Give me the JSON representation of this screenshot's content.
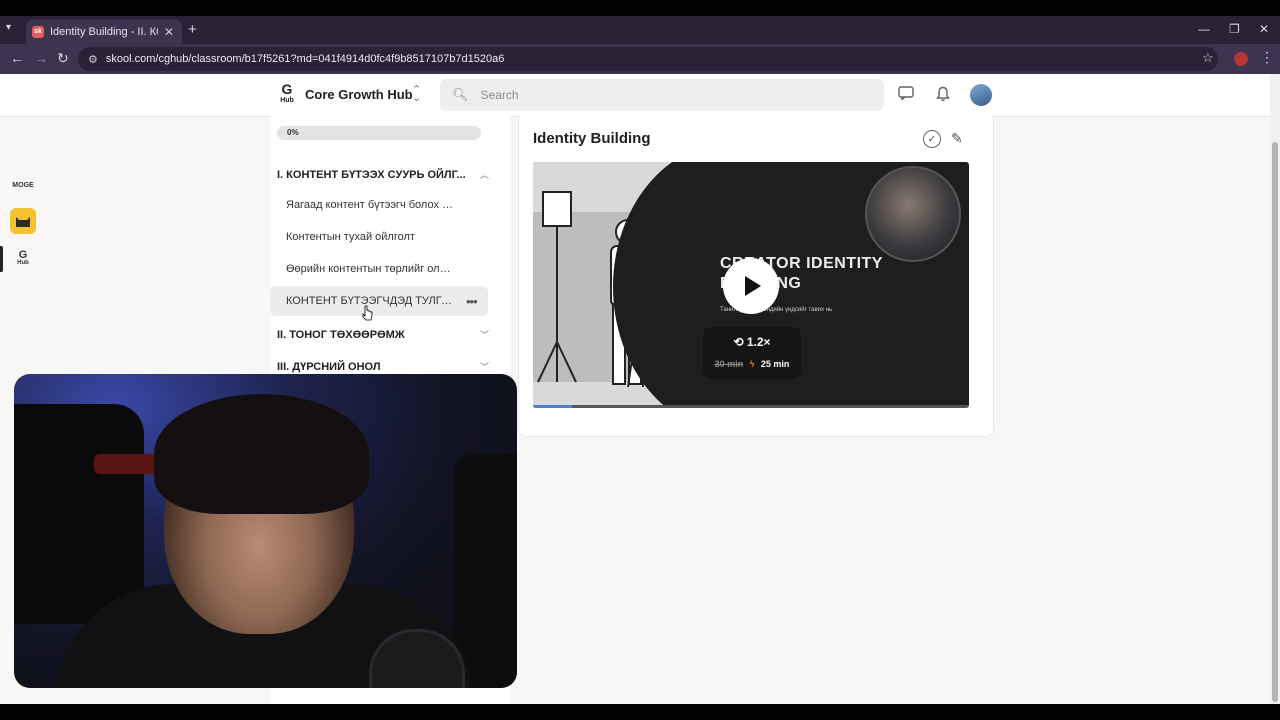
{
  "browser": {
    "tab_title": "Identity Building - II. КОНТЕНТ",
    "tab_favicon": "sk",
    "new_tab_icon": "plus-icon",
    "url": "skool.com/cghub/classroom/b17f5261?md=041f4914d0fc4f9b8517107b7d1520a6"
  },
  "header": {
    "logo_letter": "G",
    "logo_sub": "Hub",
    "group_name": "Core Growth Hub",
    "search_placeholder": "Search"
  },
  "rail": {
    "items": [
      {
        "label": "MOGE"
      },
      {
        "label": "cat-logo"
      },
      {
        "letter": "G",
        "sub": "Hub"
      }
    ]
  },
  "sidebar": {
    "progress_label": "0%",
    "progress_value": 0,
    "sections": [
      {
        "title": "I. КОНТЕНТ БҮТЭЭХ СУУРЬ ОЙЛГ...",
        "expanded": true
      },
      {
        "title": "II. ТОНОГ ТӨХӨӨРӨМЖ",
        "expanded": false
      },
      {
        "title": "III. ДҮРСНИЙ ОНОЛ",
        "expanded": false
      }
    ],
    "lessons": [
      {
        "title": "Яагаад контент бүтээгч болох ёстой в..."
      },
      {
        "title": "Контентын тухай ойлголт"
      },
      {
        "title": "Өөрийн контентын төрлийг олох нь"
      },
      {
        "title": "КОНТЕНТ БҮТЭЭГЧДЭД ТУЛГА...",
        "active": true
      }
    ]
  },
  "main": {
    "lesson_title": "Identity Building",
    "video": {
      "title_line1": "CREATOR IDENTITY",
      "title_line2": "BUILDING",
      "subtitle": "Танилцуулга брэндийн үндсийг тавих нь",
      "speed": "1.2×",
      "old_time": "30 min",
      "new_time": "25 min",
      "progress_fraction": 0.09
    }
  },
  "colors": {
    "tabbar": "#2b2238",
    "addressbar": "#3d3450",
    "page_bg": "#f8f7f5",
    "accent_orange": "#f07a2a",
    "progress_blue": "#4a7fd1"
  }
}
